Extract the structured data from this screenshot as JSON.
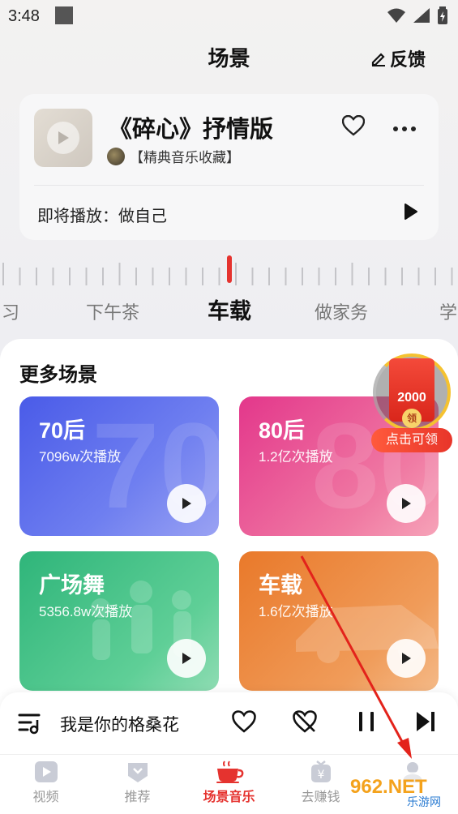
{
  "status_bar": {
    "time": "3:48"
  },
  "header": {
    "title": "场景",
    "feedback_label": "反馈"
  },
  "now_playing": {
    "title": "《碎心》抒情版",
    "channel": "【精典音乐收藏】",
    "next_label": "即将播放：做自己"
  },
  "dial": {
    "labels": [
      {
        "text": "习",
        "active": false
      },
      {
        "text": "下午茶",
        "active": false
      },
      {
        "text": "车载",
        "active": true
      },
      {
        "text": "做家务",
        "active": false
      },
      {
        "text": "学",
        "active": false
      }
    ]
  },
  "more_scenes": {
    "title": "更多场景",
    "cards": [
      {
        "title": "70后",
        "plays": "7096w次播放",
        "bg_text": "70"
      },
      {
        "title": "80后",
        "plays": "1.2亿次播放",
        "bg_text": "80"
      },
      {
        "title": "广场舞",
        "plays": "5356.8w次播放",
        "bg_text": ""
      },
      {
        "title": "车载",
        "plays": "1.6亿次播放",
        "bg_text": ""
      }
    ]
  },
  "red_packet": {
    "amount": "2000",
    "coin": "领",
    "label": "点击可领"
  },
  "mini_player": {
    "song": "我是你的格桑花"
  },
  "bottom_nav": {
    "items": [
      {
        "label": "视频",
        "icon": "video-icon",
        "active": false
      },
      {
        "label": "推荐",
        "icon": "recommend-icon",
        "active": false
      },
      {
        "label": "场景音乐",
        "icon": "coffee-cup-icon",
        "active": true
      },
      {
        "label": "去赚钱",
        "icon": "earn-money-icon",
        "active": false
      },
      {
        "label": "",
        "icon": "profile-icon",
        "active": false
      }
    ]
  },
  "watermark": {
    "text": "962.NET",
    "subtext": "乐游网"
  },
  "colors": {
    "accent_red": "#e5332f",
    "card_70": "#4a5be8",
    "card_80": "#e3378b",
    "card_dance": "#2fb57a",
    "card_car": "#e9792a"
  }
}
